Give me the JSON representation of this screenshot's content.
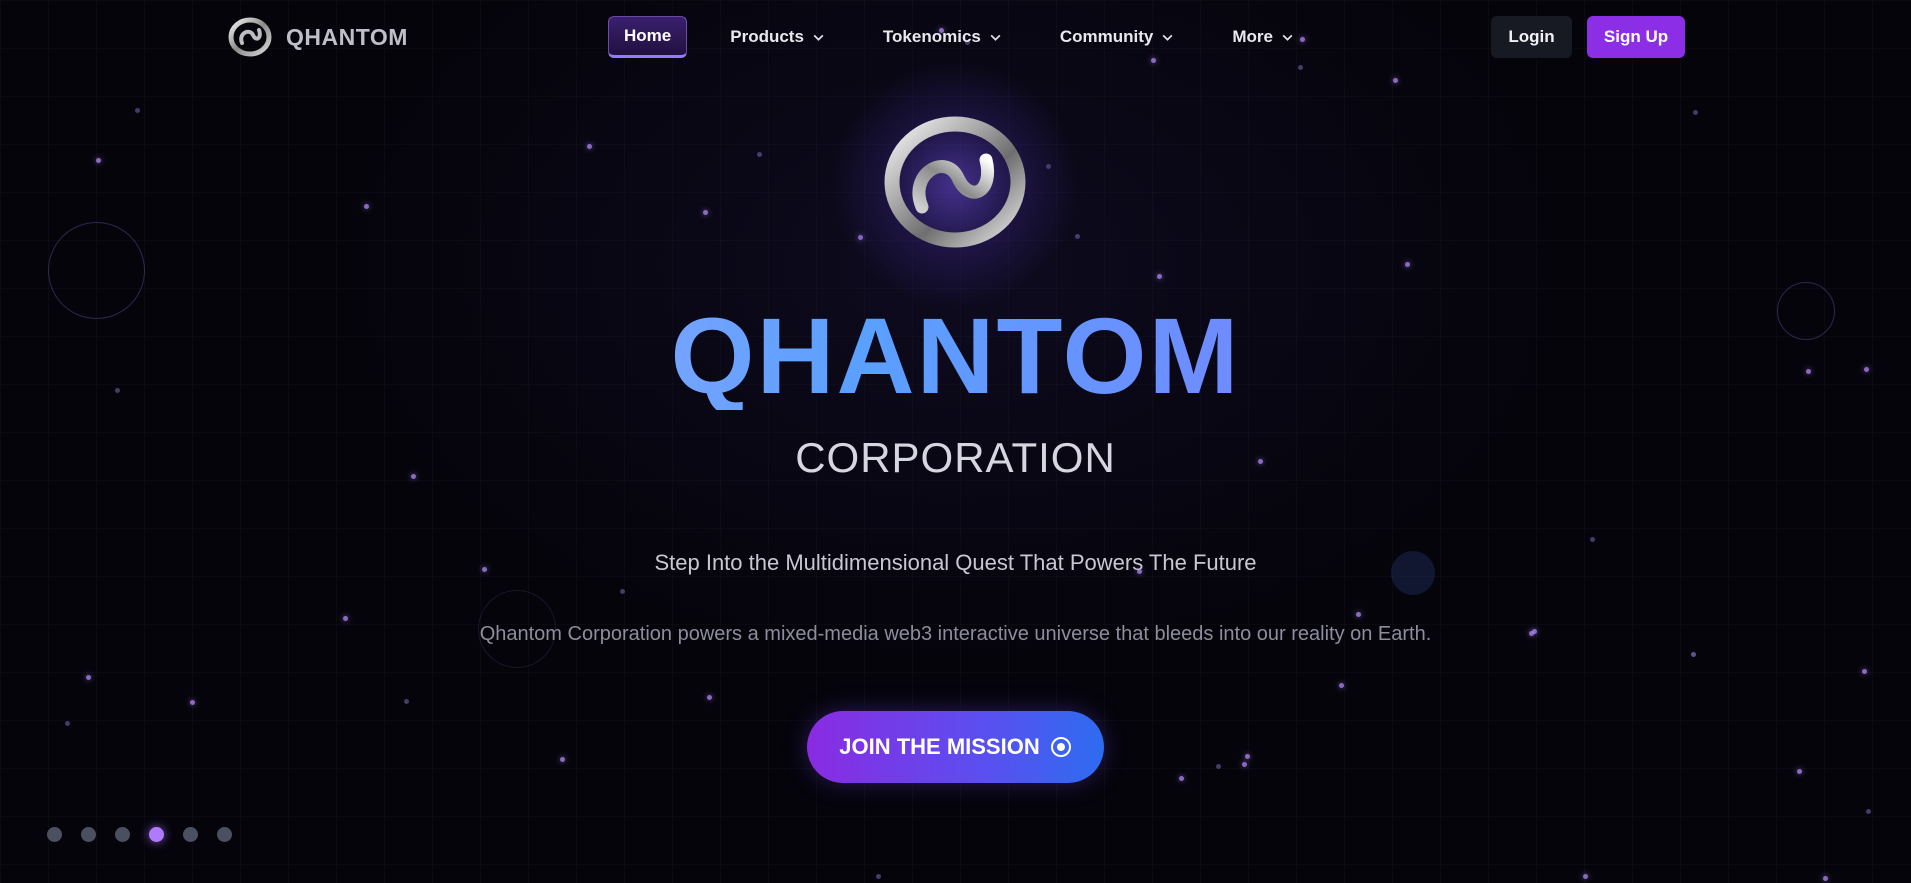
{
  "brand": {
    "name": "QHANTOM",
    "logo_icon": "infinity-ring-icon"
  },
  "nav": {
    "items": [
      {
        "label": "Home",
        "active": true,
        "has_dropdown": false
      },
      {
        "label": "Products",
        "active": false,
        "has_dropdown": true
      },
      {
        "label": "Tokenomics",
        "active": false,
        "has_dropdown": true
      },
      {
        "label": "Community",
        "active": false,
        "has_dropdown": true
      },
      {
        "label": "More",
        "active": false,
        "has_dropdown": true
      }
    ],
    "login_label": "Login",
    "signup_label": "Sign Up"
  },
  "hero": {
    "title": "QHANTOM",
    "subtitle": "CORPORATION",
    "tagline": "Step Into the Multidimensional Quest That Powers The Future",
    "description": "Qhantom Corporation powers a mixed-media web3 interactive universe that bleeds into our reality on Earth.",
    "cta_label": "JOIN THE MISSION",
    "cta_icon": "target-circle-icon"
  },
  "slider": {
    "count": 6,
    "active_index": 3
  },
  "colors": {
    "accent": "#8b2ee6",
    "background": "#05040b",
    "cta_start": "#8a2be2",
    "cta_end": "#2d6cf0",
    "dot_active": "#b07aff",
    "dot_inactive": "#4b5060"
  }
}
